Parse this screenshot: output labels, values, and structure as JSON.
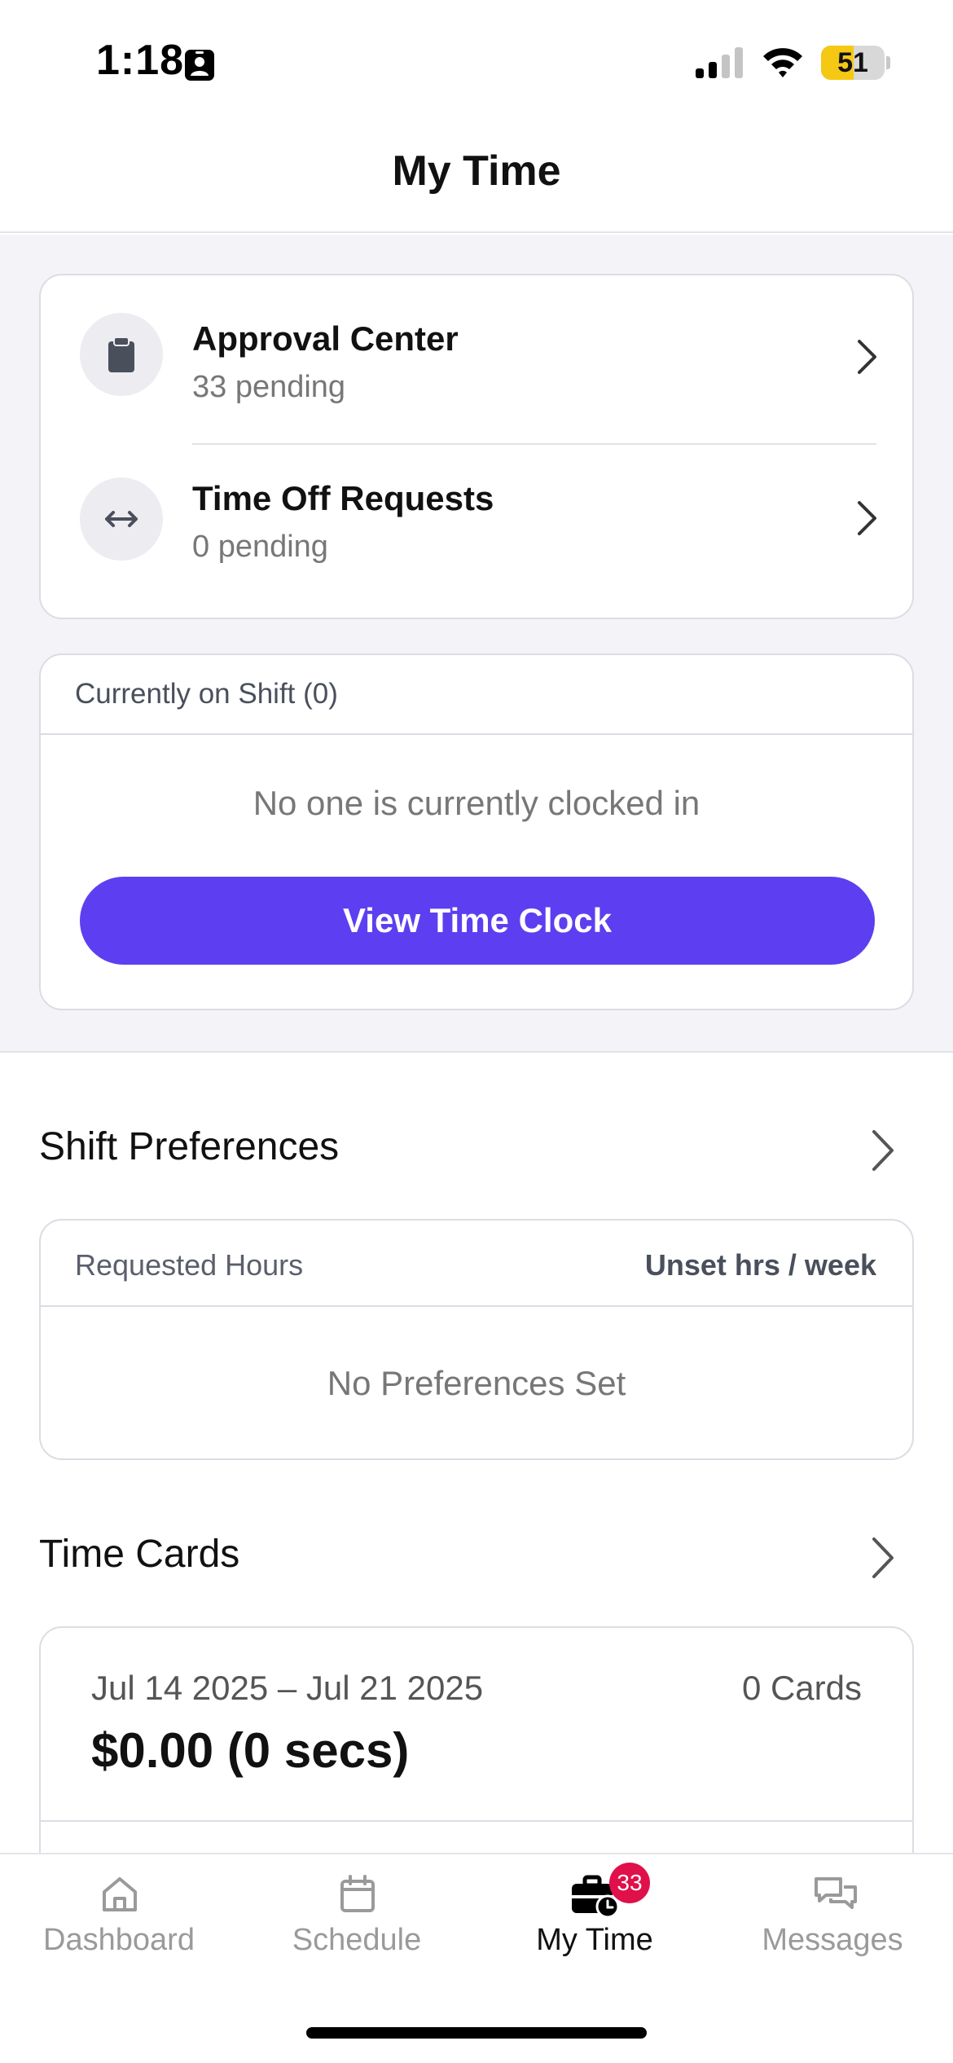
{
  "status_bar": {
    "time": "1:18",
    "battery_percent": "51",
    "battery_level": 0.51,
    "battery_color": "#f5c814",
    "icons": [
      "person-badge-icon",
      "cellular-signal-icon",
      "wifi-icon",
      "battery-icon"
    ]
  },
  "header": {
    "title": "My Time"
  },
  "approvals": {
    "items": [
      {
        "icon": "clipboard-icon",
        "title": "Approval Center",
        "subtitle": "33 pending"
      },
      {
        "icon": "horizontal-arrows-icon",
        "title": "Time Off Requests",
        "subtitle": "0 pending"
      }
    ]
  },
  "on_shift": {
    "header": "Currently on Shift (0)",
    "empty_text": "No one is currently clocked in",
    "button_label": "View Time Clock",
    "button_color": "#5d3ff1"
  },
  "shift_preferences": {
    "title": "Shift Preferences",
    "label": "Requested Hours",
    "value": "Unset hrs / week",
    "empty_text": "No Preferences Set"
  },
  "time_cards": {
    "title": "Time Cards",
    "range": "Jul 14 2025 – Jul 21 2025",
    "count": "0 Cards",
    "total": "$0.00 (0 secs)"
  },
  "tab_bar": {
    "tabs": [
      {
        "icon": "house-icon",
        "label": "Dashboard"
      },
      {
        "icon": "calendar-icon",
        "label": "Schedule"
      },
      {
        "icon": "briefcase-clock-icon",
        "label": "My Time",
        "badge": "33",
        "active": true
      },
      {
        "icon": "chat-bubbles-icon",
        "label": "Messages"
      }
    ],
    "badge_color": "#e0104a"
  }
}
